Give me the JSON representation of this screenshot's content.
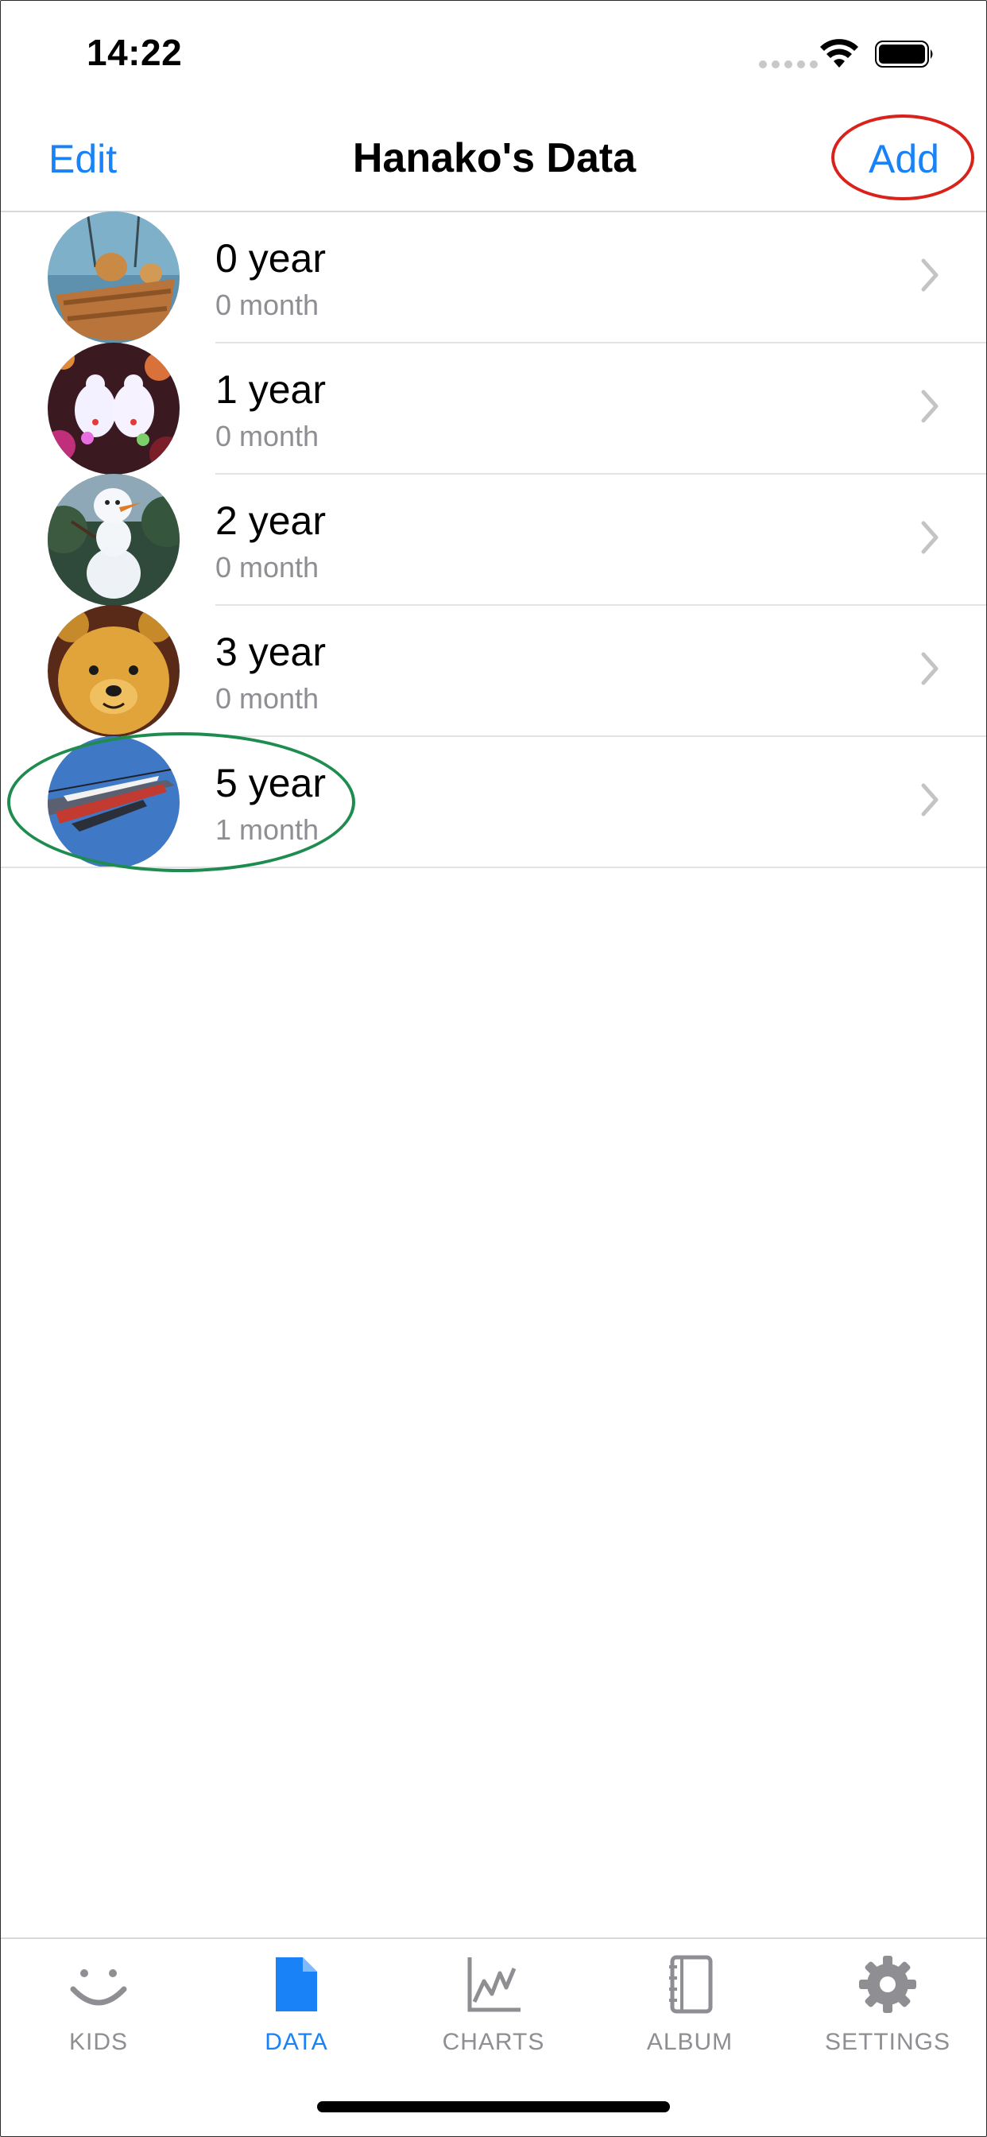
{
  "status_bar": {
    "time": "14:22",
    "icons": [
      "signal-dots-icon",
      "wifi-icon",
      "battery-icon"
    ]
  },
  "nav": {
    "edit_label": "Edit",
    "title": "Hanako's Data",
    "add_label": "Add"
  },
  "list": {
    "rows": [
      {
        "title": "0 year",
        "subtitle": "0 month",
        "thumbnail": "basket-balloon-bears-photo"
      },
      {
        "title": "1 year",
        "subtitle": "0 month",
        "thumbnail": "snowman-figures-photo"
      },
      {
        "title": "2 year",
        "subtitle": "0 month",
        "thumbnail": "olaf-statue-photo"
      },
      {
        "title": "3 year",
        "subtitle": "0 month",
        "thumbnail": "teddy-bear-photo"
      },
      {
        "title": "5 year",
        "subtitle": "1 month",
        "thumbnail": "carp-streamers-sky-photo"
      }
    ]
  },
  "tabbar": {
    "tabs": [
      {
        "label": "KIDS",
        "icon": "smiley-face-icon",
        "active": false
      },
      {
        "label": "DATA",
        "icon": "document-icon",
        "active": true
      },
      {
        "label": "CHARTS",
        "icon": "line-chart-icon",
        "active": false
      },
      {
        "label": "ALBUM",
        "icon": "notebook-icon",
        "active": false
      },
      {
        "label": "SETTINGS",
        "icon": "gear-icon",
        "active": false
      }
    ]
  },
  "colors": {
    "accent": "#1a82f7",
    "inactive": "#8e8e93",
    "annotation_red": "#d9221c",
    "annotation_green": "#1e8c4e"
  }
}
